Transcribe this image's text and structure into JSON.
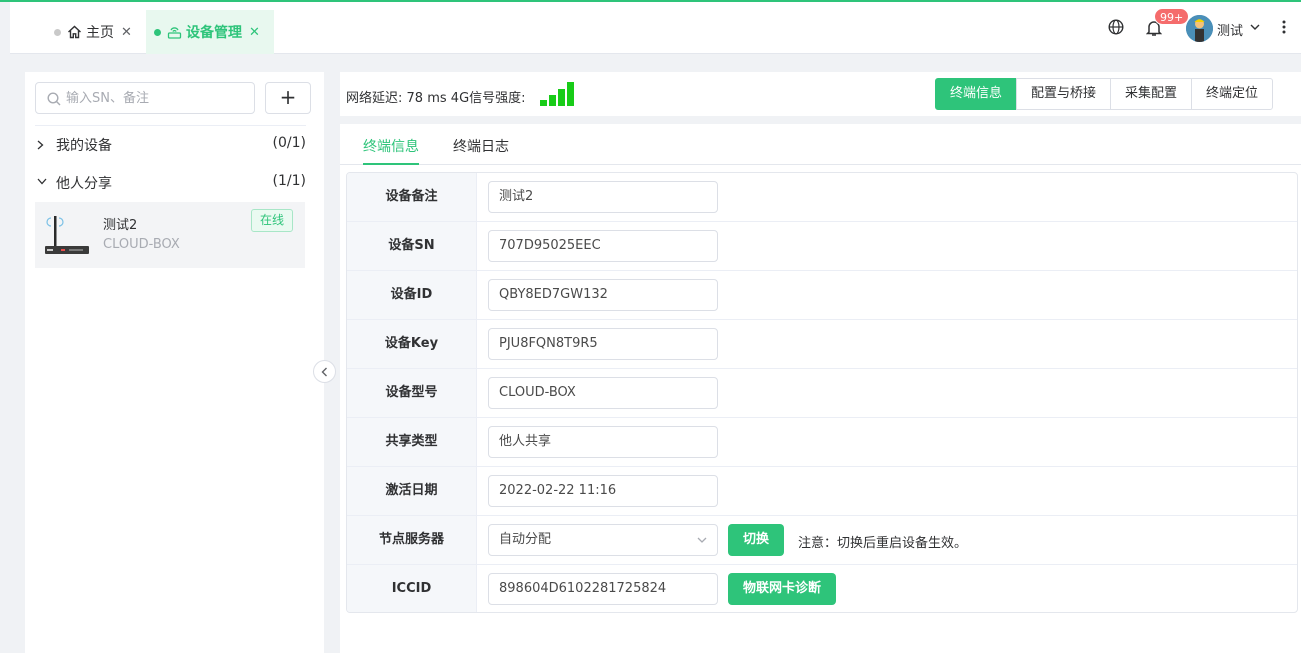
{
  "tabs": [
    {
      "label": "主页"
    },
    {
      "label": "设备管理"
    }
  ],
  "header": {
    "badge": "99+",
    "user_name": "测试"
  },
  "sidebar": {
    "search_placeholder": "输入SN、备注",
    "add_label": "+",
    "groups": [
      {
        "label": "我的设备",
        "count": "(0/1)",
        "expanded": false
      },
      {
        "label": "他人分享",
        "count": "(1/1)",
        "expanded": true
      }
    ],
    "device": {
      "name": "测试2",
      "model": "CLOUD-BOX",
      "status": "在线"
    }
  },
  "statusbar": {
    "latency_label": "网络延迟:",
    "latency_value": "78 ms",
    "signal_label": "4G信号强度:",
    "signal_bars": 4,
    "signal_color": "#18cc18",
    "buttons": [
      "终端信息",
      "配置与桥接",
      "采集配置",
      "终端定位"
    ],
    "active_button": 0
  },
  "subtabs": [
    "终端信息",
    "终端日志"
  ],
  "info": {
    "rows": [
      {
        "label": "设备备注",
        "value": "测试2"
      },
      {
        "label": "设备SN",
        "value": "707D95025EEC"
      },
      {
        "label": "设备ID",
        "value": "QBY8ED7GW132"
      },
      {
        "label": "设备Key",
        "value": "PJU8FQN8T9R5"
      },
      {
        "label": "设备型号",
        "value": "CLOUD-BOX"
      },
      {
        "label": "共享类型",
        "value": "他人共享"
      },
      {
        "label": "激活日期",
        "value": "2022-02-22 11:16"
      },
      {
        "label": "节点服务器",
        "value": "自动分配"
      },
      {
        "label": "ICCID",
        "value": "898604D6102281725824"
      }
    ],
    "switch_button": "切换",
    "switch_note": "注意：切换后重启设备生效。",
    "diagnose_button": "物联网卡诊断"
  },
  "colors": {
    "accent": "#2ec47a",
    "badge": "#f56c6c"
  }
}
